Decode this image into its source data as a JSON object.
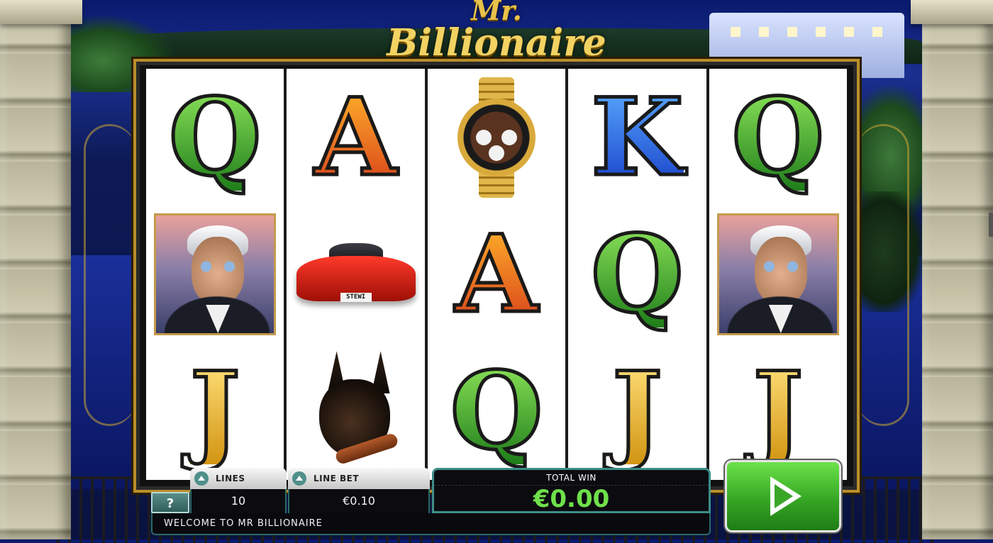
{
  "title": {
    "prefix": "Mr.",
    "name": "Billionaire"
  },
  "reels": [
    [
      {
        "type": "letter",
        "value": "Q",
        "color": "green"
      },
      {
        "type": "portrait",
        "value": ""
      },
      {
        "type": "letter",
        "value": "J",
        "color": "gold"
      }
    ],
    [
      {
        "type": "letter",
        "value": "A",
        "color": "orange"
      },
      {
        "type": "car",
        "value": "STEWI"
      },
      {
        "type": "dog",
        "value": ""
      }
    ],
    [
      {
        "type": "watch",
        "value": ""
      },
      {
        "type": "letter",
        "value": "A",
        "color": "orange"
      },
      {
        "type": "letter",
        "value": "Q",
        "color": "green"
      }
    ],
    [
      {
        "type": "letter",
        "value": "K",
        "color": "blue"
      },
      {
        "type": "letter",
        "value": "Q",
        "color": "green"
      },
      {
        "type": "letter",
        "value": "J",
        "color": "gold"
      }
    ],
    [
      {
        "type": "letter",
        "value": "Q",
        "color": "green"
      },
      {
        "type": "portrait",
        "value": ""
      },
      {
        "type": "letter",
        "value": "J",
        "color": "gold"
      }
    ]
  ],
  "controls": {
    "help_label": "?",
    "lines_label": "LINES",
    "lines_value": "10",
    "linebet_label": "LINE BET",
    "linebet_value": "€0.10",
    "total_win_label": "TOTAL WIN",
    "total_win_value": "€0.00",
    "message": "WELCOME TO MR BILLIONAIRE",
    "spin_icon": "play-icon"
  },
  "colors": {
    "accent_teal": "#3c8e88",
    "win_green": "#6fe04a",
    "spin_green": "#36a624",
    "frame_gold": "#b98f2a"
  }
}
